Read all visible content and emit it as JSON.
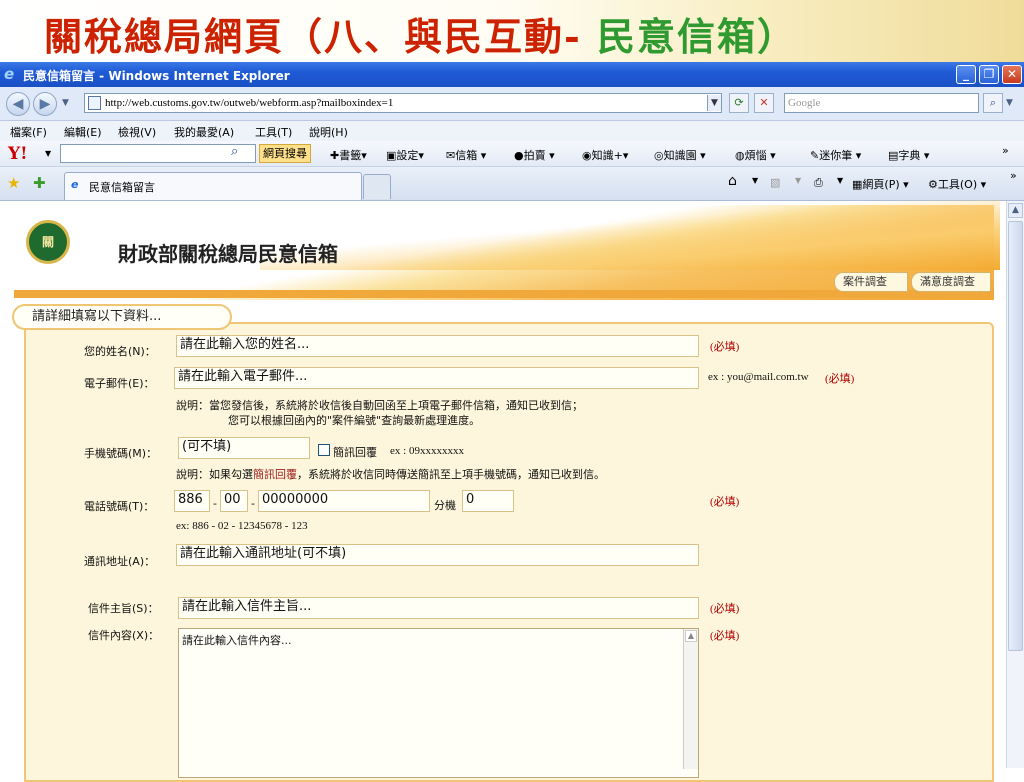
{
  "slide": {
    "title_main": "關稅總局網頁（八、與民互動-",
    "title_highlight": " 民意信箱）"
  },
  "window": {
    "title": "民意信箱留言 - Windows Internet Explorer",
    "minimize": "_",
    "restore": "❐",
    "close": "✕"
  },
  "address": {
    "url": "http://web.customs.gov.tw/outweb/webform.asp?mailboxindex=1",
    "search_placeholder": "Google"
  },
  "menu": [
    "檔案(F)",
    "編輯(E)",
    "檢視(V)",
    "我的最愛(A)",
    "工具(T)",
    "說明(H)"
  ],
  "yahoo": {
    "logo": "Y!",
    "search_button": "網頁搜尋",
    "tools": [
      "書籤",
      "設定",
      "信箱",
      "拍賣",
      "知識+",
      "知識園",
      "煩惱",
      "迷你筆",
      "字典"
    ]
  },
  "tabs": {
    "active": "民意信箱留言"
  },
  "commands": {
    "page": "網頁(P)",
    "tools": "工具(O)"
  },
  "site": {
    "title": "財政部關稅總局民意信箱",
    "btn_case": "案件調查",
    "btn_satisfaction": "滿意度調查",
    "info_header": "請詳細填寫以下資料..."
  },
  "form": {
    "name_label": "您的姓名(N)：",
    "name_value": "請在此輸入您的姓名...",
    "email_label": "電子郵件(E)：",
    "email_value": "請在此輸入電子郵件...",
    "email_example": "ex : you@mail.com.tw",
    "email_note1": "說明：當您發信後，系統將於收信後自動回函至上項電子郵件信箱，通知已收到信；",
    "email_note2": "您可以根據回函內的\"案件編號\"查詢最新處理進度。",
    "mobile_label": "手機號碼(M)：",
    "mobile_value": "(可不填)",
    "sms_label": "簡訊回覆",
    "sms_example": "ex : 09xxxxxxxx",
    "mobile_note_prefix": "說明：如果勾選",
    "mobile_note_highlight": "簡訊回覆",
    "mobile_note_suffix": "，系統將於收信同時傳送簡訊至上項手機號碼，通知已收到信。",
    "phone_label": "電話號碼(T)：",
    "phone_country": "886",
    "phone_area": "00",
    "phone_number": "00000000",
    "phone_ext_label": "分機",
    "phone_ext": "0",
    "phone_example": "ex: 886 - 02 - 12345678 - 123",
    "address_label": "通訊地址(A)：",
    "address_value": "請在此輸入通訊地址(可不填)",
    "subject_label": "信件主旨(S)：",
    "subject_value": "請在此輸入信件主旨...",
    "content_label": "信件內容(X)：",
    "content_value": "請在此輸入信件內容...",
    "required": "(必填)",
    "dash": "-"
  }
}
